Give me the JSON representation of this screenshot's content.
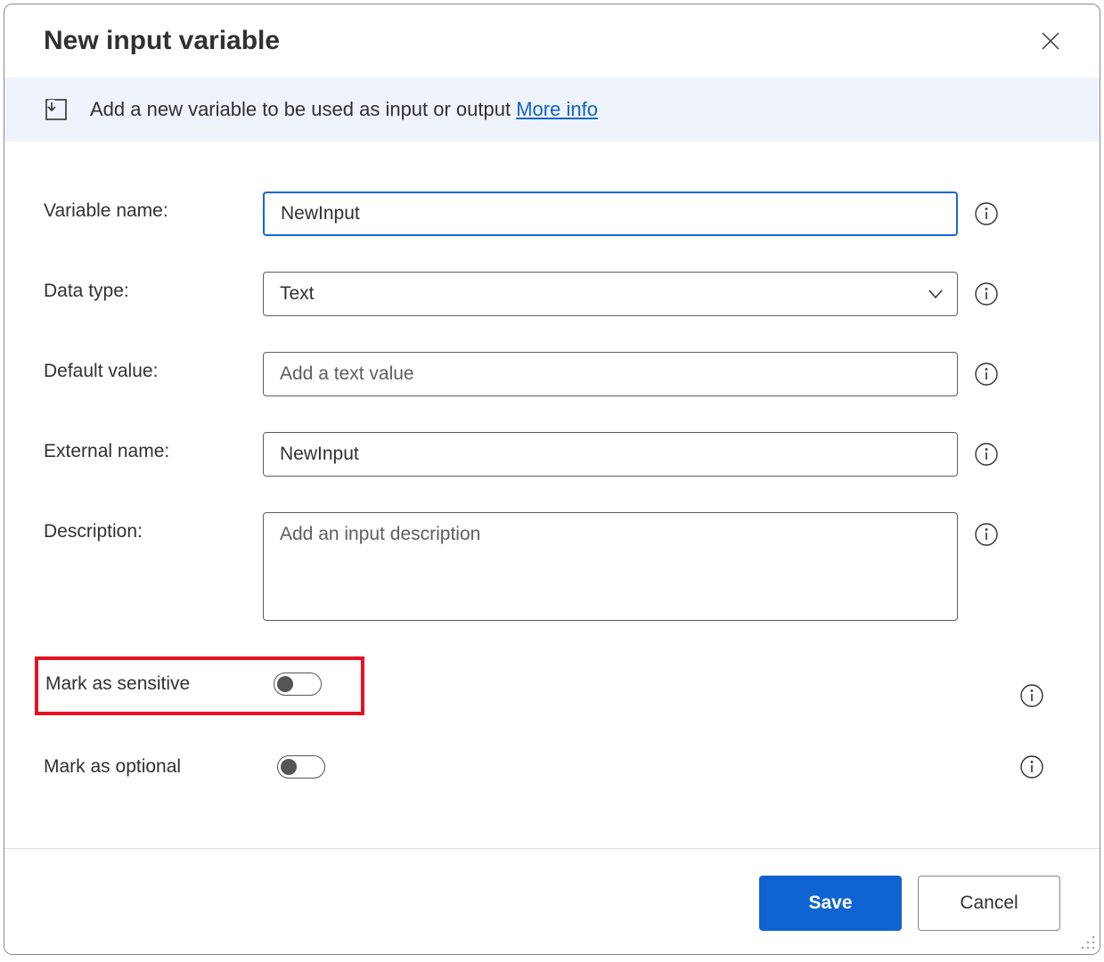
{
  "header": {
    "title": "New input variable"
  },
  "banner": {
    "text": "Add a new variable to be used as input or output ",
    "link": "More info"
  },
  "form": {
    "variable_name": {
      "label": "Variable name:",
      "value": "NewInput"
    },
    "data_type": {
      "label": "Data type:",
      "value": "Text"
    },
    "default_value": {
      "label": "Default value:",
      "placeholder": "Add a text value",
      "value": ""
    },
    "external_name": {
      "label": "External name:",
      "value": "NewInput"
    },
    "description": {
      "label": "Description:",
      "placeholder": "Add an input description",
      "value": ""
    },
    "mark_sensitive": {
      "label": "Mark as sensitive"
    },
    "mark_optional": {
      "label": "Mark as optional"
    }
  },
  "footer": {
    "save": "Save",
    "cancel": "Cancel"
  }
}
